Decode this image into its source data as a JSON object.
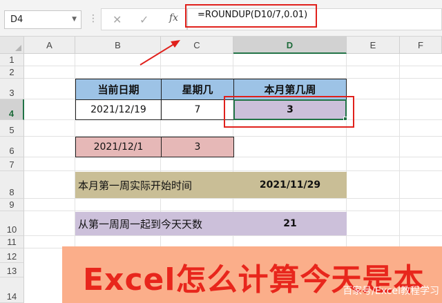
{
  "formula_bar": {
    "name_box": "D4",
    "cancel_icon": "✕",
    "enter_icon": "✓",
    "fx_label": "fx",
    "formula": "=ROUNDUP(D10/7,0.01)"
  },
  "columns": [
    "A",
    "B",
    "C",
    "D",
    "E",
    "F"
  ],
  "rows": [
    "1",
    "2",
    "3",
    "4",
    "5",
    "6",
    "7",
    "8",
    "9",
    "10",
    "11",
    "12",
    "13",
    "14"
  ],
  "selected_cell": "D4",
  "table": {
    "h_date": "当前日期",
    "h_weekday": "星期几",
    "h_week": "本月第几周",
    "date": "2021/12/19",
    "weekday": "7",
    "week_result": "3"
  },
  "helper": {
    "first_day": "2021/12/1",
    "first_day_weekday": "3"
  },
  "week_start": {
    "label": "本月第一周实际开始时间",
    "value": "2021/11/29"
  },
  "days_count": {
    "label": "从第一周周一起到今天天数",
    "value": "21"
  },
  "banner": {
    "title": "Excel怎么计算今天是本",
    "watermark": "百家号/Excel教程学习"
  },
  "colors": {
    "formula_highlight": "#e0201b",
    "header_fill": "#9dc3e6",
    "pink_fill": "#e6b8b7",
    "khaki_fill": "#c9be96",
    "lavender_fill": "#ccc0da",
    "selection": "#217346",
    "banner_bg": "#fbae8a",
    "banner_text": "#e8261c"
  }
}
